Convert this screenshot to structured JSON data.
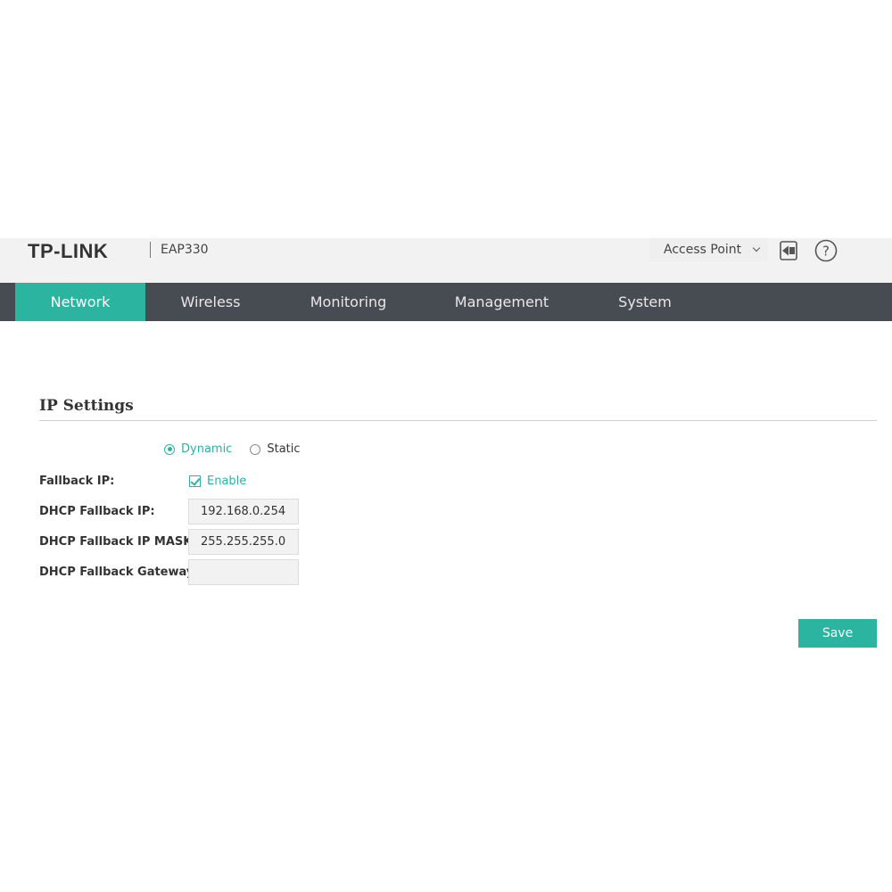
{
  "header": {
    "brand": "TP-LINK",
    "model": "EAP330",
    "mode_selector": {
      "selected": "Access Point"
    },
    "icons": {
      "logout": "logout-icon",
      "help": "help-icon"
    }
  },
  "nav": {
    "items": [
      {
        "label": "Network",
        "active": true
      },
      {
        "label": "Wireless",
        "active": false
      },
      {
        "label": "Monitoring",
        "active": false
      },
      {
        "label": "Management",
        "active": false
      },
      {
        "label": "System",
        "active": false
      }
    ]
  },
  "ip_settings": {
    "title": "IP Settings",
    "mode_options": [
      {
        "label": "Dynamic",
        "checked": true
      },
      {
        "label": "Static",
        "checked": false
      }
    ],
    "fallback_ip": {
      "label": "Fallback IP:",
      "checkbox_label": "Enable",
      "checked": true
    },
    "fields": [
      {
        "label": "DHCP Fallback IP:",
        "value": "192.168.0.254"
      },
      {
        "label": "DHCP Fallback IP MASK:",
        "value": "255.255.255.0"
      },
      {
        "label": "DHCP Fallback Gateway:",
        "value": ""
      }
    ],
    "save_label": "Save"
  },
  "colors": {
    "accent": "#2bb5a1",
    "navbar": "#474c52",
    "header_bg": "#f2f2f2"
  }
}
